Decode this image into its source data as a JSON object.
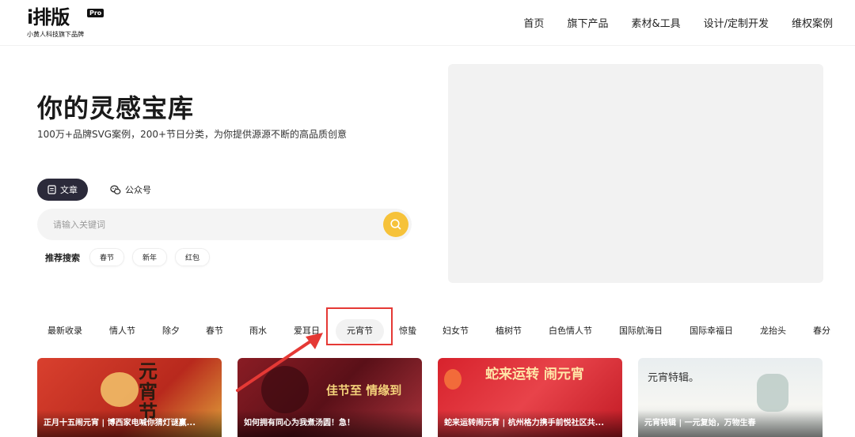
{
  "brand": {
    "name": "i排版",
    "badge": "Pro",
    "tagline": "小黄人科技旗下品牌"
  },
  "nav": {
    "items": [
      "首页",
      "旗下产品",
      "素材&工具",
      "设计/定制开发",
      "维权案例"
    ]
  },
  "hero": {
    "title": "你的灵感宝库",
    "subtitle": "100万+品牌SVG案例，200+节日分类，为你提供源源不断的高品质创意"
  },
  "tabs": {
    "article": "文章",
    "wechat": "公众号"
  },
  "search": {
    "placeholder": "请输入关键词"
  },
  "recommend": {
    "label": "推荐搜索",
    "tags": [
      "春节",
      "新年",
      "红包"
    ]
  },
  "categories": [
    "最新收录",
    "情人节",
    "除夕",
    "春节",
    "雨水",
    "爱耳日",
    "元宵节",
    "惊蛰",
    "妇女节",
    "植树节",
    "白色情人节",
    "国际航海日",
    "国际幸福日",
    "龙抬头",
    "春分"
  ],
  "active_category": "元宵节",
  "cards": [
    {
      "caption": "正月十五闹元宵 | 博西家电喊你猜灯谜赢...",
      "art": "元宵节"
    },
    {
      "caption": "如何拥有同心为我煮汤圆！急！",
      "art": "佳节至 情缘到"
    },
    {
      "caption": "蛇来运转闹元宵 | 杭州格力携手前悦社区共...",
      "art": "蛇来运转 闹元宵"
    },
    {
      "caption": "元宵特辑 | 一元复始，万物生春",
      "art": "元宵特辑。"
    }
  ],
  "colors": {
    "accent": "#f6c23a",
    "dark": "#2b2a3a",
    "highlight": "#e53935"
  }
}
